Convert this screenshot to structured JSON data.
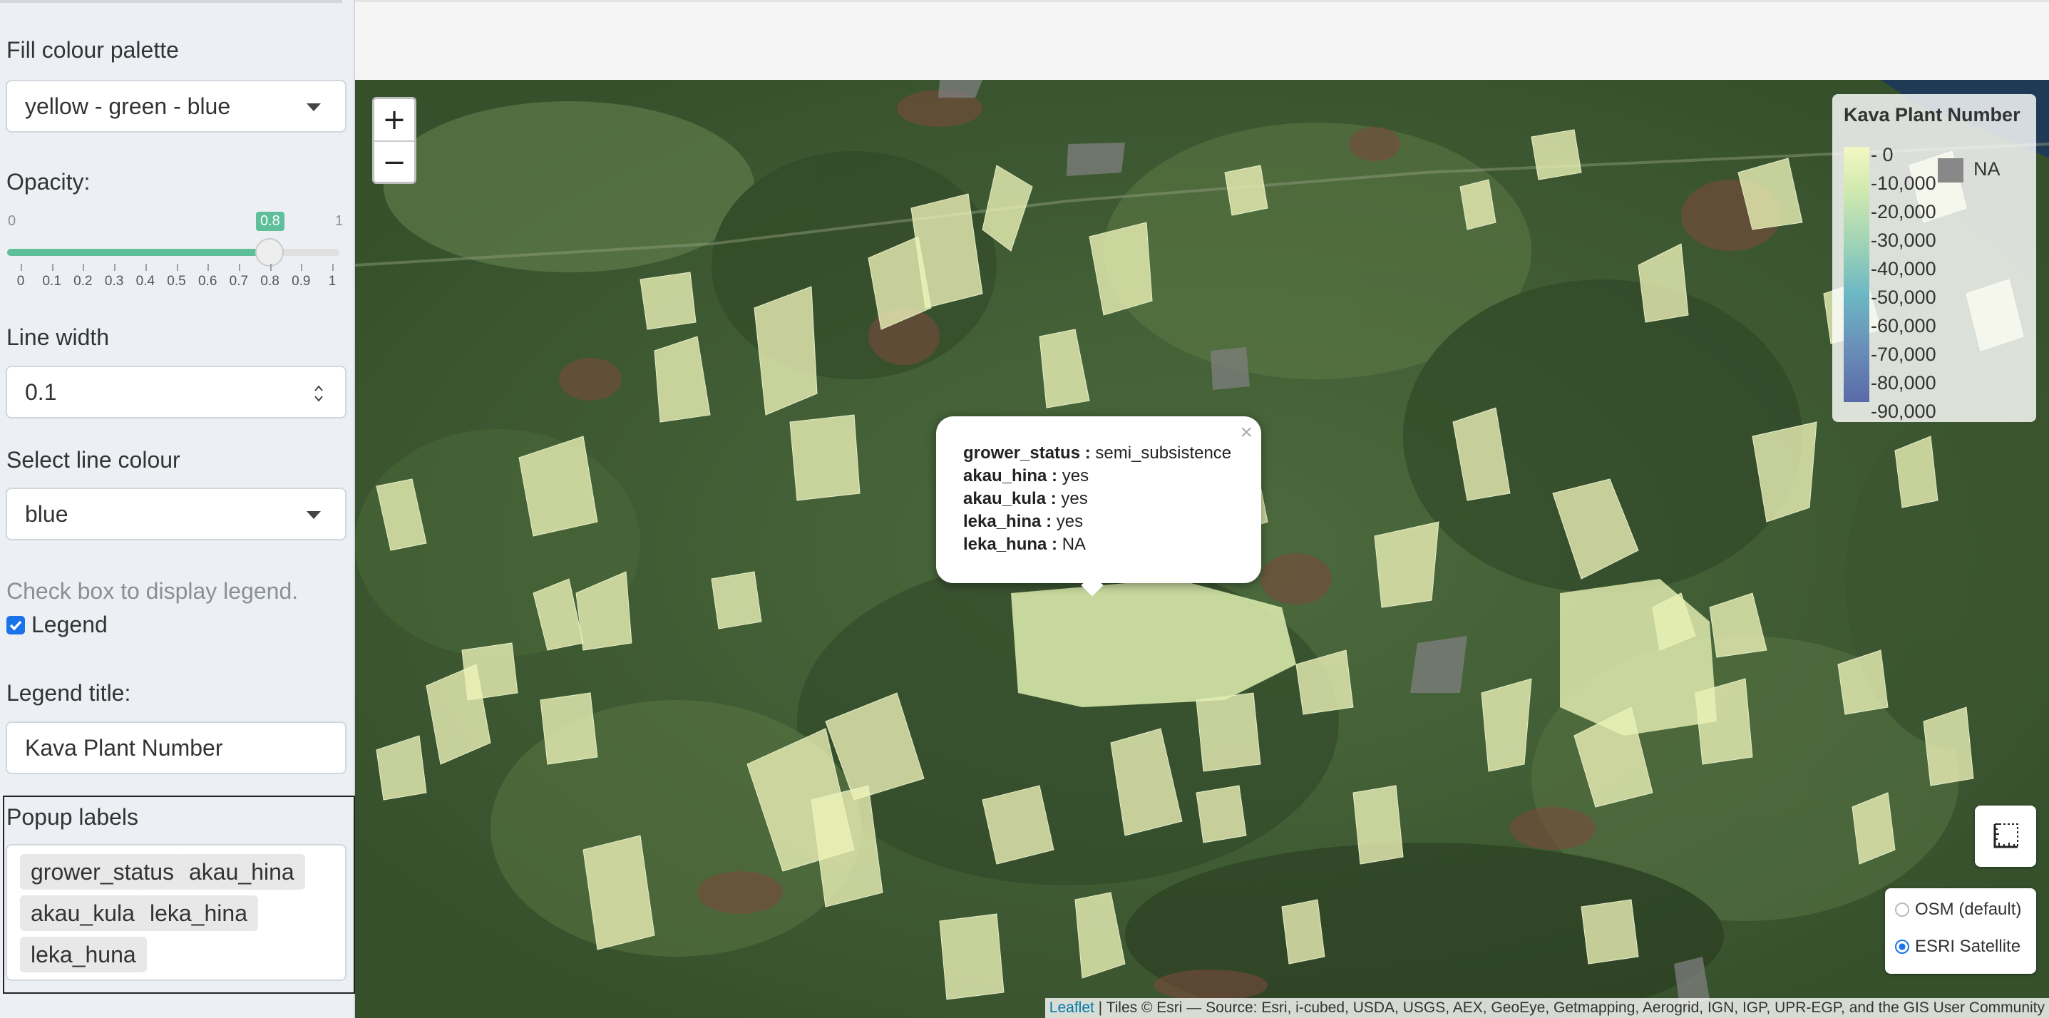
{
  "sidebar": {
    "fill_palette": {
      "label": "Fill colour palette",
      "value": "yellow - green - blue"
    },
    "opacity": {
      "label": "Opacity:",
      "min_label": "0",
      "max_label": "1",
      "value": 0.8,
      "value_label": "0.8",
      "ticks": [
        "0",
        "0.1",
        "0.2",
        "0.3",
        "0.4",
        "0.5",
        "0.6",
        "0.7",
        "0.8",
        "0.9",
        "1"
      ]
    },
    "line_width": {
      "label": "Line width",
      "value": "0.1"
    },
    "line_colour": {
      "label": "Select line colour",
      "value": "blue"
    },
    "legend_hint": "Check box to display legend.",
    "legend_checkbox": {
      "label": "Legend",
      "checked": true
    },
    "legend_title": {
      "label": "Legend title:",
      "value": "Kava Plant Number"
    },
    "popup_labels": {
      "label": "Popup labels",
      "chips": [
        "grower_status",
        "akau_hina",
        "akau_kula",
        "leka_hina",
        "leka_huna"
      ]
    }
  },
  "map": {
    "zoom_in": "+",
    "zoom_out": "−",
    "popup": {
      "close": "×",
      "rows": [
        {
          "key": "grower_status :",
          "value": "semi_subsistence"
        },
        {
          "key": "akau_hina :",
          "value": "yes"
        },
        {
          "key": "akau_kula :",
          "value": "yes"
        },
        {
          "key": "leka_hina :",
          "value": "yes"
        },
        {
          "key": "leka_huna :",
          "value": "NA"
        }
      ]
    },
    "legend": {
      "title": "Kava Plant Number",
      "labels": [
        "0",
        "10,000",
        "20,000",
        "30,000",
        "40,000",
        "50,000",
        "60,000",
        "70,000",
        "80,000",
        "90,000"
      ],
      "na_label": "NA",
      "colors": [
        "#f4f7c2",
        "#5a6aa8"
      ],
      "na_color": "#888888"
    },
    "ruler_icon": "ruler-icon",
    "layers": [
      {
        "label": "OSM (default)",
        "selected": false
      },
      {
        "label": "ESRI Satellite",
        "selected": true
      }
    ],
    "attribution": {
      "link": "Leaflet",
      "text": " | Tiles © Esri — Source: Esri, i-cubed, USDA, USGS, AEX, GeoEye, Getmapping, Aerogrid, IGN, IGP, UPR-EGP, and the GIS User Community"
    }
  }
}
